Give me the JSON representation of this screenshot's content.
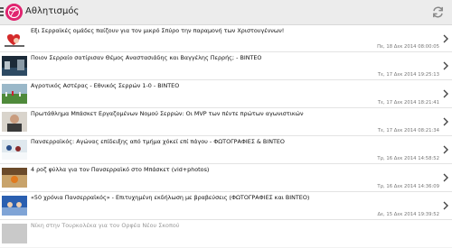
{
  "header": {
    "title": "Αθλητισμός"
  },
  "articles": [
    {
      "title": "Εξι Σερραϊκές ομάδες παίζουν για τον μικρό Σπύρο την παραμονή των Χριστουγέννων!",
      "date": "Πε, 18 Δεκ 2014 08:00:05"
    },
    {
      "title": "Ποιον Σερραίο σατίρισαν Θέμος Αναστασιάδης και Βαγγέλης Περρής; - ΒΙΝΤΕΟ",
      "date": "Τε, 17 Δεκ 2014 19:25:13"
    },
    {
      "title": "Αγροτικός Αστέρας - Εθνικός Σερρών 1-0 - ΒΙΝΤΕΟ",
      "date": "Τε, 17 Δεκ 2014 18:21:41"
    },
    {
      "title": "Πρωτάθλημα Μπάσκετ Εργαζομένων Νομού Σερρών: Οι MVP των πέντε πρώτων αγωνιστικών",
      "date": "Τε, 17 Δεκ 2014 08:21:34"
    },
    {
      "title": "Πανσερραϊκός: Αγώνας επίδειξης από τμήμα χόκεϊ επί πάγου - ΦΩΤΟΓΡΑΦΙΕΣ & ΒΙΝΤΕΟ",
      "date": "Τρ, 16 Δεκ 2014 14:58:52"
    },
    {
      "title": "4 ροζ φύλλα για τον Πανσερραϊκό στο Μπάσκετ (vid+photos)",
      "date": "Τρ, 16 Δεκ 2014 14:36:09"
    },
    {
      "title": "«50 χρόνια Πανσερραϊκός» - Επιτυχημένη εκδήλωση με βραβεύσεις (ΦΩΤΟΓΡΑΦΙΕΣ και ΒΙΝΤΕΟ)",
      "date": "Δε, 15 Δεκ 2014 19:39:52"
    }
  ],
  "partial_item": {
    "title": "Νίκη στην Τουρκολέκα για τον Ορφέα Νέου Σκοπού"
  }
}
